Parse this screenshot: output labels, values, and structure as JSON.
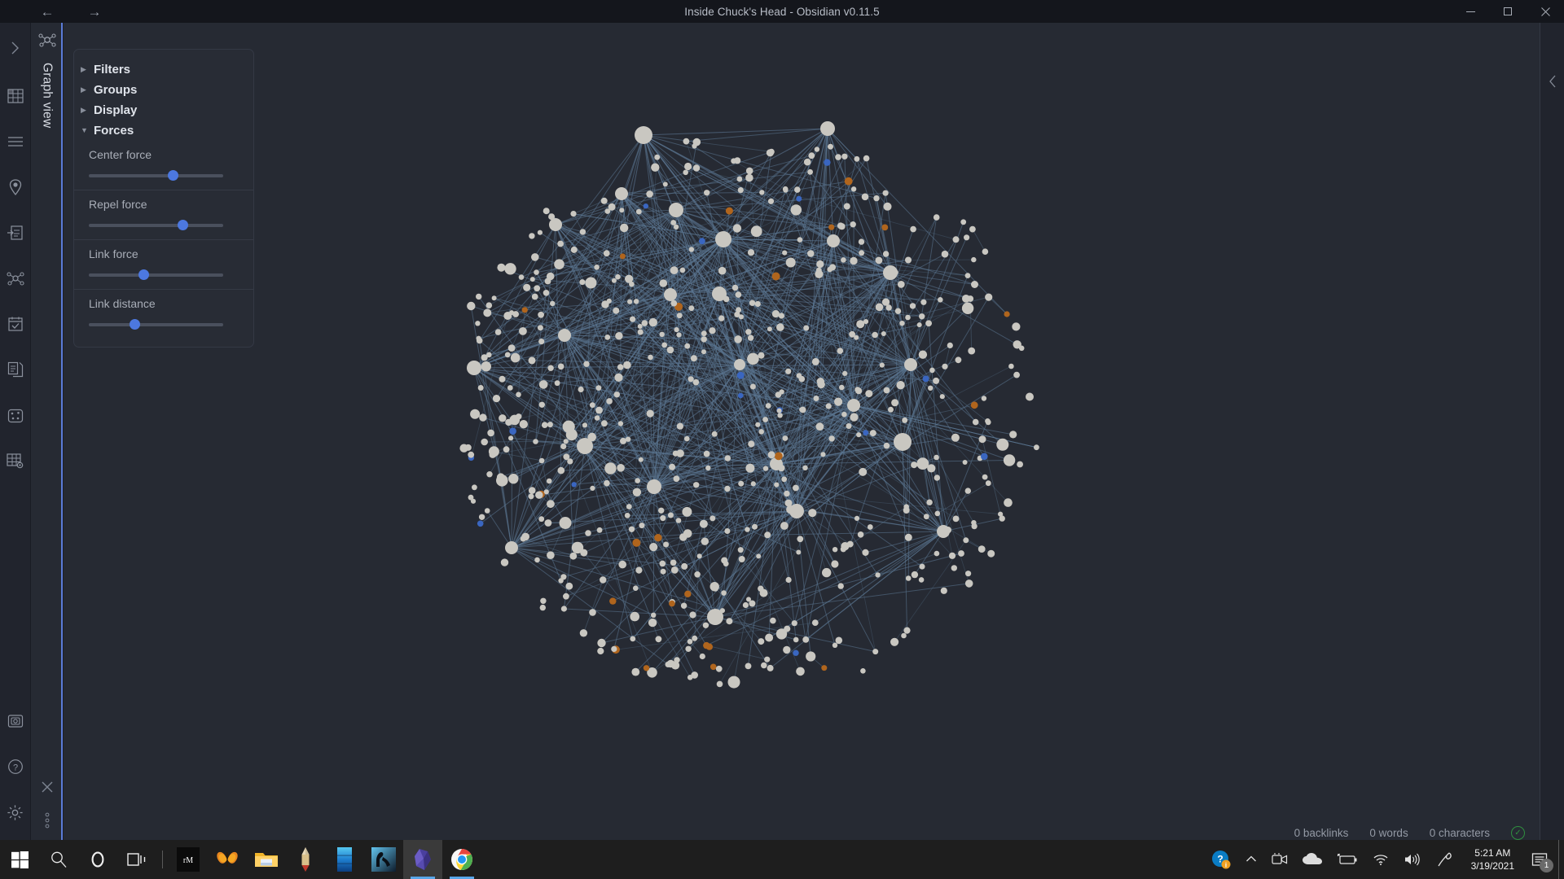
{
  "window": {
    "title": "Inside Chuck's Head - Obsidian v0.11.5",
    "nav_back": "←",
    "nav_forward": "→",
    "minimize": "—",
    "maximize": "□",
    "close": "✕"
  },
  "ribbon": {
    "items": [
      {
        "name": "expand-chevron-icon",
        "label": "›"
      },
      {
        "name": "table-icon",
        "label": ""
      },
      {
        "name": "list-lines-icon",
        "label": ""
      },
      {
        "name": "location-pin-icon",
        "label": ""
      },
      {
        "name": "import-note-icon",
        "label": ""
      },
      {
        "name": "graph-nodes-icon",
        "label": ""
      },
      {
        "name": "calendar-check-icon",
        "label": ""
      },
      {
        "name": "copy-documents-icon",
        "label": ""
      },
      {
        "name": "dice-icon",
        "label": ""
      },
      {
        "name": "table-settings-icon",
        "label": ""
      }
    ],
    "bottom_items": [
      {
        "name": "vault-camera-icon",
        "label": ""
      },
      {
        "name": "help-icon",
        "label": "?"
      },
      {
        "name": "settings-gear-icon",
        "label": ""
      }
    ]
  },
  "tabstrip": {
    "tab_label": "Graph view",
    "close_label": "✕",
    "more_label": "⋮"
  },
  "right_sidebar": {
    "collapse_label": "‹"
  },
  "panel": {
    "sections": [
      {
        "label": "Filters",
        "expanded": false,
        "triangle": "▶"
      },
      {
        "label": "Groups",
        "expanded": false,
        "triangle": "▶"
      },
      {
        "label": "Display",
        "expanded": false,
        "triangle": "▶"
      },
      {
        "label": "Forces",
        "expanded": true,
        "triangle": "▼"
      }
    ],
    "forces": [
      {
        "label": "Center force",
        "value": 63
      },
      {
        "label": "Repel force",
        "value": 70
      },
      {
        "label": "Link force",
        "value": 41
      },
      {
        "label": "Link distance",
        "value": 34
      }
    ]
  },
  "statusbar": {
    "backlinks": "0 backlinks",
    "words": "0 words",
    "characters": "0 characters",
    "sync_icon": "✓"
  },
  "taskbar": {
    "items": [
      {
        "name": "start-button",
        "state": "idle"
      },
      {
        "name": "search-icon",
        "state": "idle"
      },
      {
        "name": "cortana-icon",
        "state": "idle"
      },
      {
        "name": "task-view-icon",
        "state": "idle"
      },
      {
        "name": "remarkable-app-icon",
        "state": "idle"
      },
      {
        "name": "evernote-app-icon",
        "state": "idle"
      },
      {
        "name": "file-explorer-icon",
        "state": "idle"
      },
      {
        "name": "pencil-app-icon",
        "state": "idle"
      },
      {
        "name": "blue-app-icon",
        "state": "idle"
      },
      {
        "name": "reader-app-icon",
        "state": "idle"
      },
      {
        "name": "obsidian-app-icon",
        "state": "active"
      },
      {
        "name": "chrome-app-icon",
        "state": "running"
      }
    ],
    "tray": {
      "time": "5:21 AM",
      "date": "3/19/2021",
      "notification_count": "1"
    }
  },
  "graph": {
    "background": "#262a33",
    "link_color": "#5b7692",
    "node_default_color": "#c9c7c1",
    "node_accent_colors": [
      "#b0651d",
      "#3a66c0"
    ],
    "node_count": 620,
    "link_count": 1450
  }
}
